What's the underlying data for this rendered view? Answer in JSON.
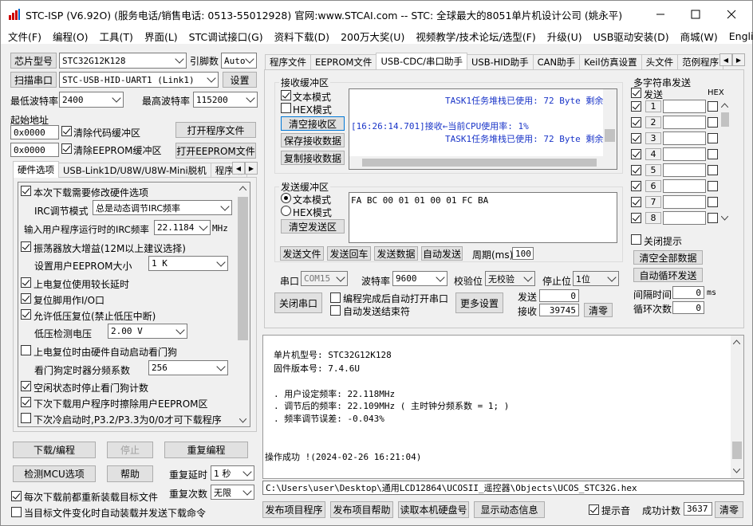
{
  "window": {
    "title": "STC-ISP (V6.92O) (服务电话/销售电话: 0513-55012928) 官网:www.STCAI.com  -- STC: 全球最大的8051单片机设计公司 (姚永平)"
  },
  "menu": [
    "文件(F)",
    "编程(O)",
    "工具(T)",
    "界面(L)",
    "STC调试接口(G)",
    "资料下载(D)",
    "200万大奖(U)",
    "视频教学/技术论坛/选型(F)",
    "升级(U)",
    "USB驱动安装(D)",
    "商城(W)",
    "English"
  ],
  "left": {
    "chip_btn": "芯片型号",
    "chip_value": "STC32G12K128",
    "pin_label": "引脚数",
    "pin_value": "Auto",
    "scan_btn": "扫描串口",
    "port_value": "STC-USB-HID-UART1 (Link1)",
    "settings_btn": "设置",
    "min_baud_label": "最低波特率",
    "min_baud": "2400",
    "max_baud_label": "最高波特率",
    "max_baud": "115200",
    "start_addr_label": "起始地址",
    "addr1": "0x0000",
    "clear_code": "清除代码缓冲区",
    "open_prog": "打开程序文件",
    "addr2": "0x0000",
    "clear_eeprom": "清除EEPROM缓冲区",
    "open_eeprom": "打开EEPROM文件",
    "tabs": [
      "硬件选项",
      "USB-Link1D/U8W/U8W-Mini脱机",
      "程序加"
    ],
    "opts": {
      "o1": "本次下载需要修改硬件选项",
      "irc_mode_label": "IRC调节模式",
      "irc_mode": "总是动态调节IRC频率",
      "freq_label": "输入用户程序运行时的IRC频率",
      "freq": "22.1184",
      "mhz": "MHz",
      "o2": "振荡器放大增益(12M以上建议选择)",
      "eeprom_label": "设置用户EEPROM大小",
      "eeprom_val": "1   K",
      "o3": "上电复位使用较长延时",
      "o4": "复位脚用作I/O口",
      "o5": "允许低压复位(禁止低压中断)",
      "lv_label": "低压检测电压",
      "lv_val": "2.00 V",
      "o6": "上电复位时由硬件自动启动看门狗",
      "wdt_label": "看门狗定时器分频系数",
      "wdt_val": "256",
      "o7": "空闲状态时停止看门狗计数",
      "o8": "下次下载用户程序时擦除用户EEPROM区",
      "o9": "下次冷启动时,P3.2/P3.3为0/0才可下载程序"
    },
    "download_btn": "下载/编程",
    "stop_btn": "停止",
    "reprog_btn": "重复编程",
    "detect_btn": "检测MCU选项",
    "help_btn": "帮助",
    "delay_label": "重复延时",
    "delay_val": "1 秒",
    "count_label": "重复次数",
    "count_val": "无限",
    "reload1": "每次下载前都重新装载目标文件",
    "reload2": "当目标文件变化时自动装载并发送下载命令"
  },
  "right": {
    "tabs": [
      "程序文件",
      "EEPROM文件",
      "USB-CDC/串口助手",
      "USB-HID助手",
      "CAN助手",
      "Keil仿真设置",
      "头文件",
      "范例程序"
    ],
    "recv": {
      "title": "接收缓冲区",
      "text_mode": "文本模式",
      "hex_mode": "HEX模式",
      "clear": "清空接收区",
      "save": "保存接收数据",
      "copy": "复制接收数据",
      "lines": [
        "TASK1任务堆栈已使用: 72 Byte 剩余",
        "[16:26:14.701]接收←当前CPU使用率: 1%",
        "TASK1任务堆栈已使用: 72 Byte 剩余"
      ]
    },
    "send": {
      "title": "发送缓冲区",
      "text_mode": "文本模式",
      "hex_mode": "HEX模式",
      "clear": "清空发送区",
      "data": "FA BC 00 01 01 00 01 FC BA",
      "send_file": "发送文件",
      "send_cr": "发送回车",
      "send_data": "发送数据",
      "auto_send": "自动发送",
      "period_label": "周期(ms)",
      "period": "100"
    },
    "multi": {
      "title": "多字符串发送",
      "send_label": "发送",
      "hex_label": "HEX",
      "rows": [
        "1",
        "2",
        "3",
        "4",
        "5",
        "6",
        "7",
        "8"
      ],
      "close_tip": "关闭提示",
      "clear_all": "清空全部数据",
      "auto_loop": "自动循环发送",
      "interval_label": "间隔时间",
      "interval": "0",
      "ms": "ms",
      "loop_label": "循环次数",
      "loop": "0"
    },
    "serial": {
      "port_label": "串口",
      "port": "COM15",
      "baud_label": "波特率",
      "baud": "9600",
      "parity_label": "校验位",
      "parity": "无校验",
      "stop_label": "停止位",
      "stop": "1位",
      "close_btn": "关闭串口",
      "auto_open": "编程完成后自动打开串口",
      "auto_end": "自动发送结束符",
      "more_btn": "更多设置",
      "send_label": "发送",
      "send_count": "0",
      "recv_label": "接收",
      "recv_count": "39745",
      "clear_btn": "清零"
    },
    "log": [
      "单片机型号: STC32G12K128",
      "固件版本号: 7.4.6U",
      "",
      ". 用户设定频率: 22.118MHz",
      ". 调节后的频率: 22.109MHz ( 主时钟分频系数 = 1; )",
      ". 频率调节误差: -0.043%",
      "",
      "",
      "操作成功 !(2024-02-26 16:21:04)"
    ],
    "path": "C:\\Users\\user\\Desktop\\通用LCD12864\\UCOSII_遥控器\\Objects\\UCOS_STC32G.hex",
    "bottom": {
      "publish": "发布项目程序",
      "publish_help": "发布项目帮助",
      "read_disk": "读取本机硬盘号",
      "dyn_info": "显示动态信息",
      "beep": "提示音",
      "success_label": "成功计数",
      "success": "3637",
      "clear": "清零"
    }
  }
}
